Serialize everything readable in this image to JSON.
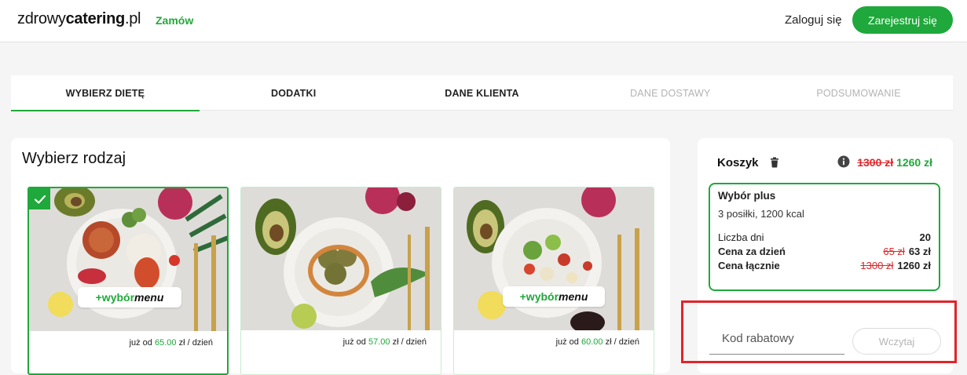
{
  "header": {
    "logo_prefix": "zdrowy",
    "logo_bold": "catering",
    "logo_suffix": ".pl",
    "order_link": "Zamów",
    "login_link": "Zaloguj się",
    "register_button": "Zarejestruj się"
  },
  "steps": [
    {
      "label": "WYBIERZ DIETĘ",
      "state": "active"
    },
    {
      "label": "DODATKI",
      "state": "enabled"
    },
    {
      "label": "DANE KLIENTA",
      "state": "enabled"
    },
    {
      "label": "DANE DOSTAWY",
      "state": "disabled"
    },
    {
      "label": "PODSUMOWANIE",
      "state": "disabled"
    }
  ],
  "main": {
    "title": "Wybierz rodzaj",
    "diets": [
      {
        "price_prefix": "już od",
        "price": "65.00",
        "price_suffix": "zł / dzień",
        "badge_plus": "+wybór",
        "badge_menu": "menu",
        "selected": true
      },
      {
        "price_prefix": "już od",
        "price": "57.00",
        "price_suffix": "zł / dzień",
        "selected": false
      },
      {
        "price_prefix": "już od",
        "price": "60.00",
        "price_suffix": "zł / dzień",
        "badge_plus": "+wybór",
        "badge_menu": "menu",
        "selected": false
      }
    ]
  },
  "cart": {
    "title": "Koszyk",
    "total_old": "1300 zł",
    "total_new": "1260 zł",
    "item": {
      "name": "Wybór plus",
      "desc": "3 posiłki, 1200 kcal",
      "days_label": "Liczba dni",
      "days_value": "20",
      "per_day_label": "Cena za dzień",
      "per_day_old": "65 zł",
      "per_day_new": "63 zł",
      "total_label": "Cena łącznie",
      "total_old": "1300 zł",
      "total_new": "1260 zł"
    }
  },
  "promo": {
    "placeholder": "Kod rabatowy",
    "button": "Wczytaj"
  },
  "colors": {
    "accent": "#1fa83b",
    "strike": "#e0252a",
    "highlight": "#e0252a"
  }
}
